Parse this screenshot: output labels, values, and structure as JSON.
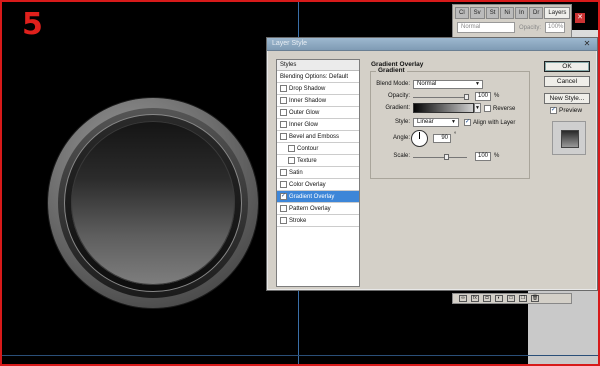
{
  "step_number": "5",
  "layers_panel": {
    "tabs": [
      "Cl",
      "Sv",
      "St",
      "Ni",
      "In",
      "Dr",
      "Layers"
    ],
    "blend_mode": "Normal",
    "opacity_label": "Opacity:",
    "opacity_value": "100%"
  },
  "dialog": {
    "title": "Layer Style",
    "close_label": "✕",
    "styles_header": "Styles",
    "styles": [
      {
        "label": "Blending Options: Default",
        "checkbox": false,
        "checked": false,
        "indent": false,
        "selected": false
      },
      {
        "label": "Drop Shadow",
        "checkbox": true,
        "checked": false,
        "indent": false,
        "selected": false
      },
      {
        "label": "Inner Shadow",
        "checkbox": true,
        "checked": false,
        "indent": false,
        "selected": false
      },
      {
        "label": "Outer Glow",
        "checkbox": true,
        "checked": false,
        "indent": false,
        "selected": false
      },
      {
        "label": "Inner Glow",
        "checkbox": true,
        "checked": false,
        "indent": false,
        "selected": false
      },
      {
        "label": "Bevel and Emboss",
        "checkbox": true,
        "checked": false,
        "indent": false,
        "selected": false
      },
      {
        "label": "Contour",
        "checkbox": true,
        "checked": false,
        "indent": true,
        "selected": false
      },
      {
        "label": "Texture",
        "checkbox": true,
        "checked": false,
        "indent": true,
        "selected": false
      },
      {
        "label": "Satin",
        "checkbox": true,
        "checked": false,
        "indent": false,
        "selected": false
      },
      {
        "label": "Color Overlay",
        "checkbox": true,
        "checked": false,
        "indent": false,
        "selected": false
      },
      {
        "label": "Gradient Overlay",
        "checkbox": true,
        "checked": true,
        "indent": false,
        "selected": true
      },
      {
        "label": "Pattern Overlay",
        "checkbox": true,
        "checked": false,
        "indent": false,
        "selected": false
      },
      {
        "label": "Stroke",
        "checkbox": true,
        "checked": false,
        "indent": false,
        "selected": false
      }
    ],
    "section_title": "Gradient Overlay",
    "group_title": "Gradient",
    "blend_mode_label": "Blend Mode:",
    "blend_mode_value": "Normal",
    "opacity_label": "Opacity:",
    "opacity_value": "100",
    "opacity_unit": "%",
    "gradient_label": "Gradient:",
    "reverse_label": "Reverse",
    "reverse_checked": false,
    "style_label": "Style:",
    "style_value": "Linear",
    "align_label": "Align with Layer",
    "align_checked": true,
    "angle_label": "Angle:",
    "angle_value": "90",
    "angle_unit": "°",
    "scale_label": "Scale:",
    "scale_value": "100",
    "scale_unit": "%",
    "ok_label": "OK",
    "cancel_label": "Cancel",
    "new_style_label": "New Style...",
    "preview_label": "Preview",
    "preview_checked": true
  },
  "colors": {
    "selection": "#3d86d8",
    "step_number": "#e0201c",
    "frame": "#d71a1a"
  }
}
